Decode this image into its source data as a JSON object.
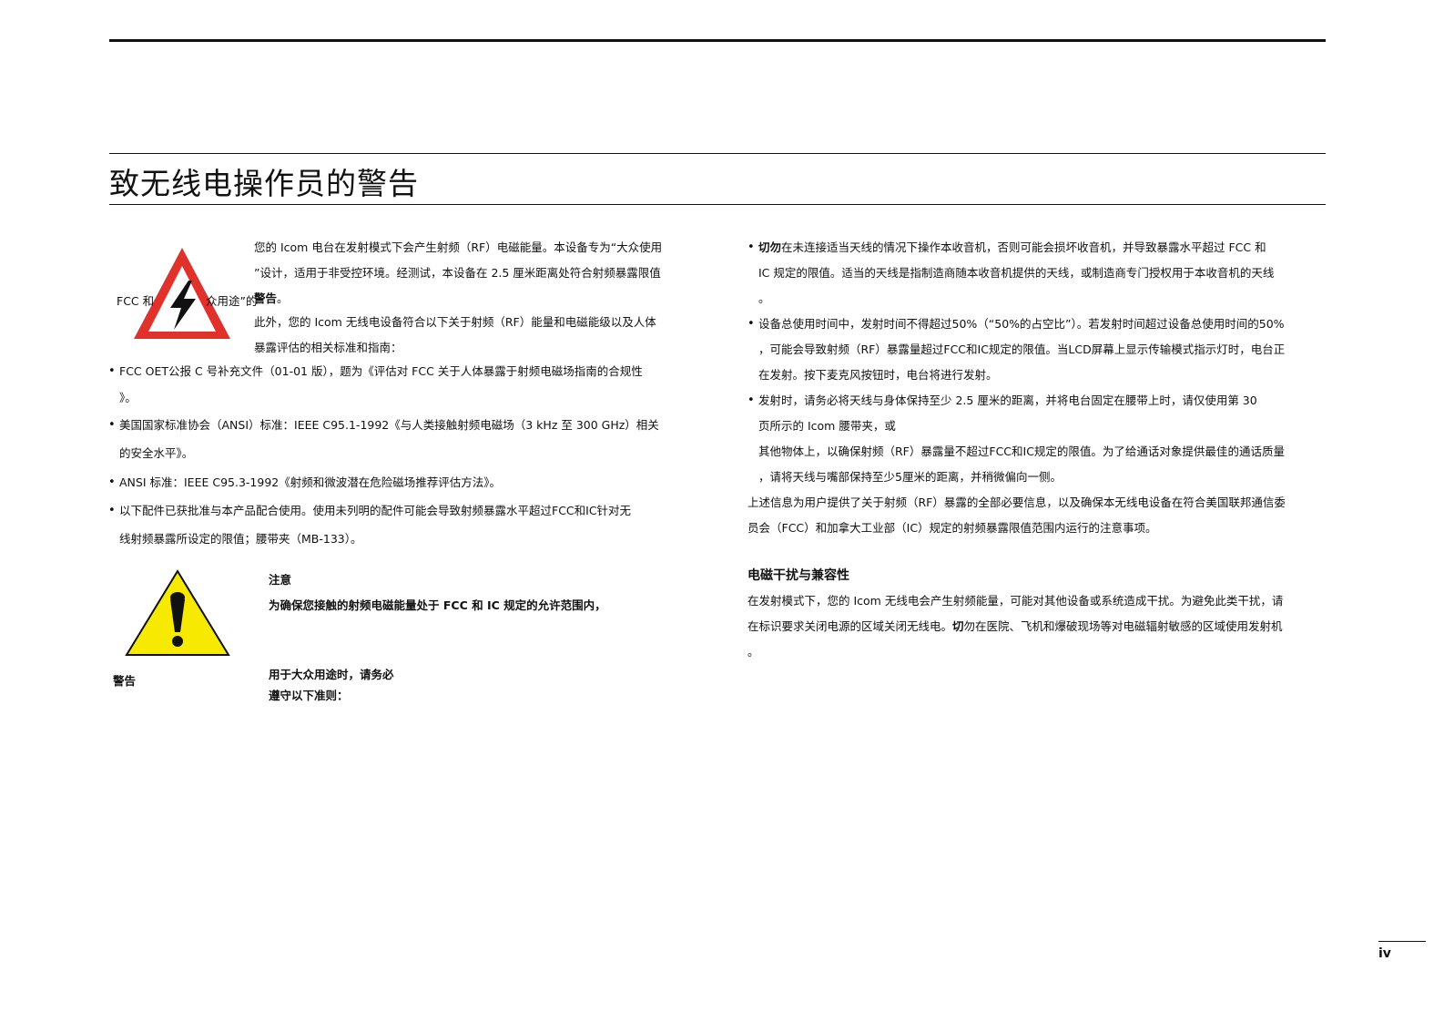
{
  "page": {
    "title": "致无线电操作员的警告",
    "page_number": "iv"
  },
  "left": {
    "intro_lines": [
      "您的 Icom 电台在发射模式下会产生射频（RF）电磁能量。本设备专为“大众使用",
      "”设计，适用于非受控环境。经测试，本设备在 2.5 厘米距离处符合射频暴露限值"
    ],
    "fcc_left": "FCC 和",
    "fcc_right": "众用途”的",
    "warning_word": "警告",
    "stop": "。",
    "intro2_lines": [
      "此外，您的 Icom 无线电设备符合以下关于射频（RF）能量和电磁能级以及人体",
      "暴露评估的相关标准和指南："
    ],
    "bullets": [
      [
        "FCC OET公报 C 号补充文件（01-01 版），题为《评估对 FCC 关于人体暴露于射频电磁场指南的合规性",
        "》。"
      ],
      [
        "美国国家标准协会（ANSI）标准：IEEE C95.1-1992《与人类接触射频电磁场（3 kHz 至 300 GHz）相关",
        "的安全水平》。"
      ],
      [
        "ANSI 标准：IEEE C95.3-1992《射频和微波潜在危险磁场推荐评估方法》。"
      ],
      [
        "以下配件已获批准与本产品配合使用。使用未列明的配件可能会导致射频暴露水平超过FCC和IC针对无",
        "线射频暴露所设定的限值；腰带夹（MB-133）。"
      ]
    ],
    "caution_title": "注意",
    "caution_line": "为确保您接触的射频电磁能量处于 FCC 和 IC 规定的允许范围内，",
    "caution_label": "警告",
    "caution_follow": [
      "用于大众用途时，请务必",
      "遵守以下准则："
    ]
  },
  "right": {
    "bullet1": {
      "bold": "切勿",
      "rest": "在未连接适当天线的情况下操作本收音机，否则可能会损坏收音机，并导致暴露水平超过 FCC 和",
      "lines": [
        "IC 规定的限值。适当的天线是指制造商随本收音机提供的天线，或制造商专门授权用于本收音机的天线",
        "。"
      ]
    },
    "bullet2": [
      "设备总使用时间中，发射时间不得超过50%（“50%的占空比”）。若发射时间超过设备总使用时间的50%",
      "，可能会导致射频（RF）暴露量超过FCC和IC规定的限值。当LCD屏幕上显示传输模式指示灯时，电台正",
      "在发射。按下麦克风按钮时，电台将进行发射。"
    ],
    "bullet3": [
      "发射时，请务必将天线与身体保持至少 2.5 厘米的距离，并将电台固定在腰带上时，请仅使用第 30",
      "页所示的 Icom 腰带夹，或",
      "其他物体上，以确保射频（RF）暴露量不超过FCC和IC规定的限值。为了给通话对象提供最佳的通话质量",
      "，请将天线与嘴部保持至少5厘米的距离，并稍微偏向一侧。"
    ],
    "summary": [
      "上述信息为用户提供了关于射频（RF）暴露的全部必要信息，以及确保本无线电设备在符合美国联邦通信委",
      "员会（FCC）和加拿大工业部（IC）规定的射频暴露限值范围内运行的注意事项。"
    ],
    "emc_title": "电磁干扰与兼容性",
    "emc_line1": "在发射模式下，您的 Icom 无线电会产生射频能量，可能对其他设备或系统造成干扰。为避免此类干扰，请",
    "emc_line2_a": "在标识要求关闭电源的区域关闭无线电。",
    "emc_line2_bold": "切",
    "emc_line2_b": "勿在医院、飞机和爆破现场等对电磁辐射敏感的区域使用发射机",
    "emc_line3": "。"
  },
  "colors": {
    "hazard_red": "#e0312b",
    "caution_yellow": "#f7ea00"
  },
  "icons": [
    "high-voltage-warning-icon",
    "caution-exclamation-icon"
  ]
}
